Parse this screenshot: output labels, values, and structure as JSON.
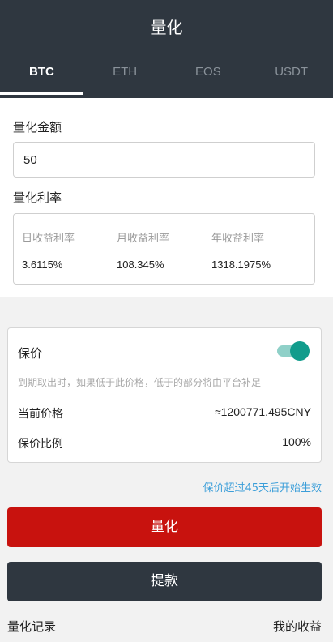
{
  "header": {
    "title": "量化"
  },
  "tabs": [
    {
      "label": "BTC",
      "active": true
    },
    {
      "label": "ETH",
      "active": false
    },
    {
      "label": "EOS",
      "active": false
    },
    {
      "label": "USDT",
      "active": false
    }
  ],
  "amount": {
    "label": "量化金额",
    "value": "50"
  },
  "rates": {
    "label": "量化利率",
    "daily": {
      "title": "日收益利率",
      "value": "3.6115%"
    },
    "monthly": {
      "title": "月收益利率",
      "value": "108.345%"
    },
    "yearly": {
      "title": "年收益利率",
      "value": "1318.1975%"
    }
  },
  "protection": {
    "label": "保价",
    "enabled": true,
    "hint": "到期取出时，如果低于此价格，低于的部分将由平台补足",
    "current_price_label": "当前价格",
    "current_price_value": "≈1200771.495CNY",
    "ratio_label": "保价比例",
    "ratio_value": "100%"
  },
  "notice": "保价超过45天后开始生效",
  "buttons": {
    "quantify": "量化",
    "withdraw": "提款"
  },
  "records": {
    "label": "量化记录",
    "my_earnings": "我的收益"
  },
  "colors": {
    "header_bg": "#2f3740",
    "primary_red": "#c8120e",
    "toggle_on": "#119c8c",
    "link_blue": "#3b9ed9"
  }
}
